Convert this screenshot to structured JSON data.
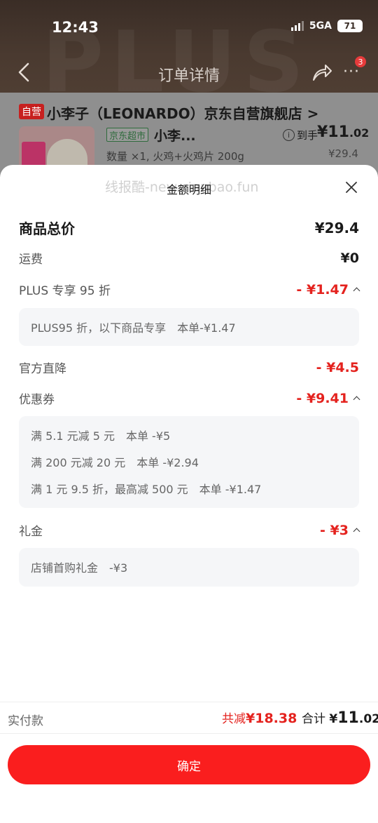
{
  "status": {
    "time": "12:43",
    "network": "5GA",
    "battery": "71"
  },
  "nav": {
    "title": "订单详情",
    "more_badge": "3"
  },
  "product": {
    "self_tag": "自营",
    "store_name": "小李子（LEONARDO）京东自营旗舰店 >",
    "market_tag": "京东超市",
    "name": "小李...",
    "got_label": "到手",
    "got_price_main": "¥11",
    "got_price_dec": ".02",
    "qty_spec": "数量 ×1, 火鸡+火鸡片 200g",
    "orig_price": "¥29.4"
  },
  "sheet": {
    "title": "金额明细",
    "watermark": "线报酷-new.xianbao.fun",
    "rows": {
      "total": {
        "label": "商品总价",
        "value": "¥29.4"
      },
      "shipping": {
        "label": "运费",
        "value": "¥0"
      },
      "plus": {
        "label": "PLUS 专享 95 折",
        "value": "- ¥1.47"
      },
      "official": {
        "label": "官方直降",
        "value": "- ¥4.5"
      },
      "coupon": {
        "label": "优惠券",
        "value": "- ¥9.41"
      },
      "gift": {
        "label": "礼金",
        "value": "- ¥3"
      }
    },
    "plus_detail": [
      "PLUS95 折，以下商品专享　本单-¥1.47"
    ],
    "coupon_detail": [
      "满 5.1 元减 5 元　本单 -¥5",
      "满 200 元减 20 元　本单 -¥2.94",
      "满 1 元 9.5 折，最高减 500 元　本单 -¥1.47"
    ],
    "gift_detail": [
      "店铺首购礼金　-¥3"
    ]
  },
  "footer": {
    "paid_label": "实付款",
    "saved_label": "共减",
    "saved_value": "¥18.38",
    "total_label": "合计",
    "total_yen": "¥",
    "total_main": "11",
    "total_dec": ".02",
    "confirm_label": "确定"
  },
  "colors": {
    "accent": "#fa1e1e",
    "discount": "#e4221e"
  }
}
